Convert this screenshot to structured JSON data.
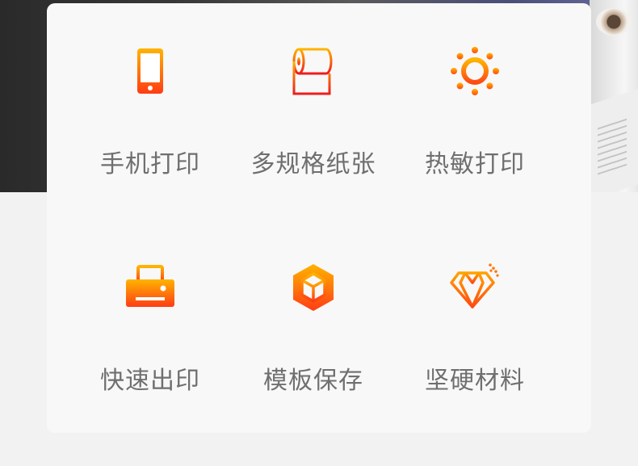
{
  "features": [
    {
      "label": "手机打印",
      "icon": "smartphone-icon"
    },
    {
      "label": "多规格纸张",
      "icon": "paper-roll-icon"
    },
    {
      "label": "热敏打印",
      "icon": "sun-icon"
    },
    {
      "label": "快速出印",
      "icon": "printer-icon"
    },
    {
      "label": "模板保存",
      "icon": "cube-icon"
    },
    {
      "label": "坚硬材料",
      "icon": "diamond-icon"
    }
  ],
  "colors": {
    "icon_gradient_top": "#ffb400",
    "icon_gradient_bottom": "#ff3c14",
    "label": "#6f6f6f",
    "card": "#f8f8f8",
    "page": "#f2f2f2"
  }
}
